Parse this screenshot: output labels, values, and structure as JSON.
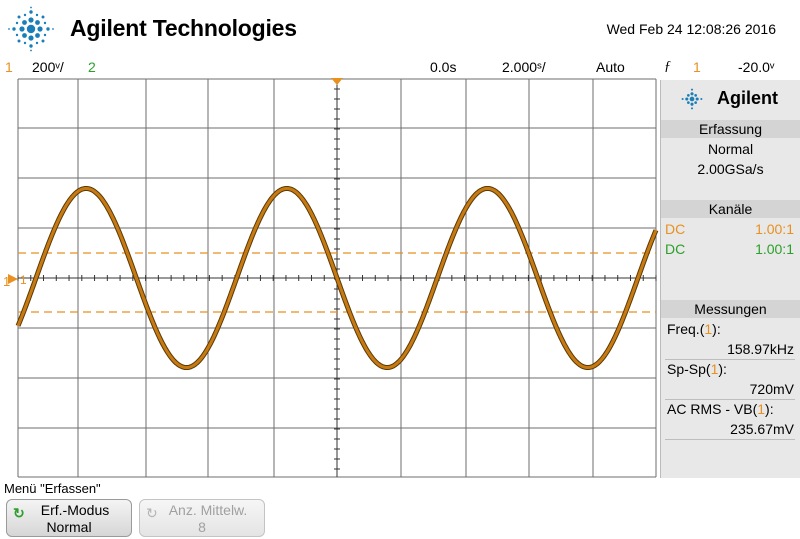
{
  "header": {
    "brand": "Agilent Technologies",
    "datetime": "Wed Feb 24 12:08:26 2016"
  },
  "status_bar": {
    "ch1_number": "1",
    "ch1_scale": "200ᵛ/",
    "ch2_number": "2",
    "delay": "0.0s",
    "timebase": "2.000ˢ/",
    "trigger_mode": "Auto",
    "trigger_icon": "ƒ",
    "trigger_source": "1",
    "trigger_level": "-20.0ᵛ"
  },
  "colors": {
    "ch1": "#e89020",
    "ch2": "#2aa02a",
    "trace": "#c87a12",
    "trace_dark": "#5a3a08"
  },
  "panel": {
    "logo_text": "Agilent",
    "acq_header": "Erfassung",
    "acq_mode": "Normal",
    "acq_rate": "2.00GSa/s",
    "channels_header": "Kanäle",
    "ch1_coupling": "DC",
    "ch1_probe": "1.00:1",
    "ch2_coupling": "DC",
    "ch2_probe": "1.00:1",
    "meas_header": "Messungen",
    "meas": [
      {
        "name": "Freq.",
        "channel": "1",
        "value": "158.97kHz"
      },
      {
        "name": "Sp-Sp",
        "channel": "1",
        "value": "720mV"
      },
      {
        "name": "AC RMS - VB",
        "channel": "1",
        "value": "235.67mV"
      }
    ]
  },
  "screen": {
    "ch1_marker": "1",
    "waveform": {
      "channel": "1",
      "frequency_khz": 158.97,
      "peak_to_peak_mv": 720
    }
  },
  "menu": {
    "title": "Menü \"Erfassen\"",
    "softkeys": [
      {
        "line1": "Erf.-Modus",
        "line2": "Normal",
        "enabled": true
      },
      {
        "line1": "Anz. Mittelw.",
        "line2": "8",
        "enabled": false
      }
    ]
  }
}
